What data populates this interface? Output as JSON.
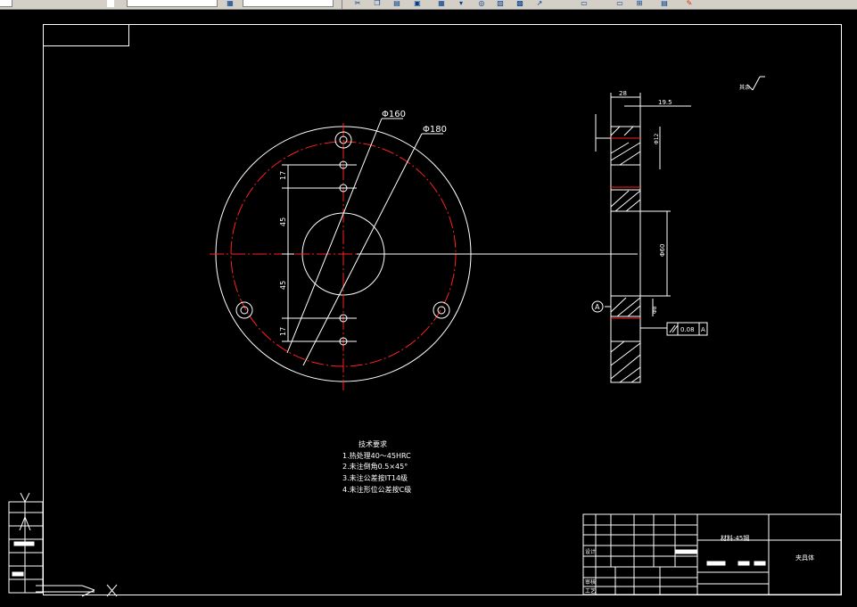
{
  "colors": {
    "background": "#000000",
    "line": "#ffffff",
    "centerline": "#ff2020",
    "toolbar": "#d4d0c8"
  },
  "toolbar": {
    "icons": [
      "layer-icon",
      "cut-icon",
      "copy-icon",
      "paste-icon",
      "match-properties-icon",
      "undo-icon",
      "redo-icon",
      "pan-icon",
      "zoom-icon",
      "properties-icon",
      "design-center-icon",
      "palette-icon",
      "help-icon"
    ]
  },
  "title_stamp": {
    "surface_code": "其余"
  },
  "front_view": {
    "dim_inner_diameter": "Φ160",
    "dim_outer_diameter": "Φ180",
    "dim_17_top": "17",
    "dim_45_top": "45",
    "dim_45_bottom": "45",
    "dim_17_bottom": "17"
  },
  "side_view": {
    "dim_width": "28",
    "dim_step": "19.5",
    "dim_bore": "Φ60",
    "dim_small_1": "Φ12",
    "dim_small_2": "Φ8",
    "datum_label": "A",
    "tolerance_value": "0.08",
    "tolerance_datum": "A"
  },
  "notes": {
    "title": "技术要求",
    "items": [
      "1.热处理40～45HRC",
      "2.未注倒角0.5×45°",
      "3.未注公差按IT14级",
      "4.未注形位公差按C级"
    ]
  },
  "title_block": {
    "material": "材料:45钢",
    "part_name": "夹具体",
    "row_labels": [
      "设计",
      "审核",
      "工艺"
    ]
  }
}
